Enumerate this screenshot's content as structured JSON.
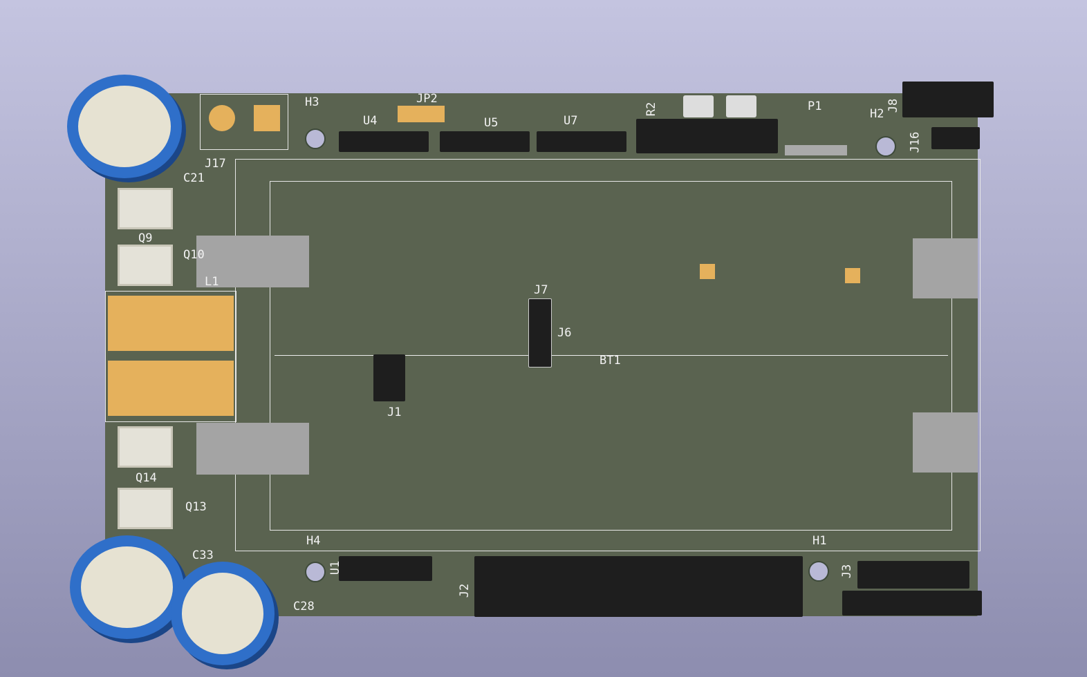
{
  "view": "3D PCB render",
  "colors": {
    "board": "#5a6350",
    "silkscreen": "#f2f2f2",
    "copper_pad": "#e5b15c",
    "capacitor": "#2f6fc9",
    "background_top": "#c4c4e0"
  },
  "labels": {
    "H3": "H3",
    "JP2": "JP2",
    "U4": "U4",
    "U5": "U5",
    "U7": "U7",
    "R2": "R2",
    "P1": "P1",
    "H2": "H2",
    "J8": "J8",
    "J16": "J16",
    "J17": "J17",
    "C21": "C21",
    "Q9": "Q9",
    "Q10": "Q10",
    "L1": "L1",
    "J7": "J7",
    "J6": "J6",
    "BT1": "BT1",
    "J1": "J1",
    "Q14": "Q14",
    "Q13": "Q13",
    "C33": "C33",
    "C28": "C28",
    "H4": "H4",
    "U1": "U1",
    "J2": "J2",
    "H1": "H1",
    "J3": "J3"
  }
}
